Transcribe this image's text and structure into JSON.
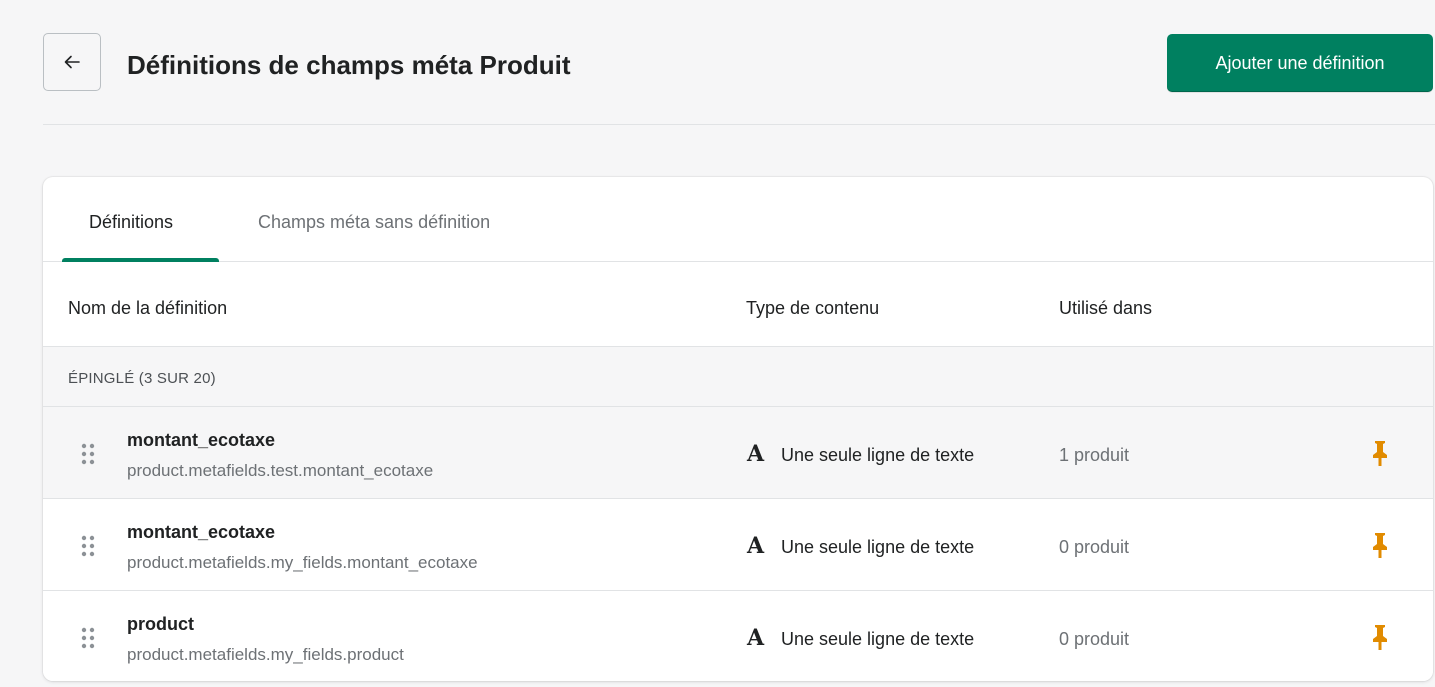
{
  "header": {
    "title": "Définitions de champs méta Produit",
    "primary_action": "Ajouter une définition",
    "back_icon": "arrow-left-icon"
  },
  "tabs": [
    {
      "label": "Définitions",
      "active": true
    },
    {
      "label": "Champs méta sans définition",
      "active": false
    }
  ],
  "table": {
    "columns": {
      "name": "Nom de la définition",
      "type": "Type de contenu",
      "used": "Utilisé dans"
    },
    "section_label": "ÉPINGLÉ (3 SUR 20)",
    "type_icon_glyph": "A",
    "rows": [
      {
        "name": "montant_ecotaxe",
        "key": "product.metafields.test.montant_ecotaxe",
        "type": "Une seule ligne de texte",
        "used": "1 produit",
        "pinned": true
      },
      {
        "name": "montant_ecotaxe",
        "key": "product.metafields.my_fields.montant_ecotaxe",
        "type": "Une seule ligne de texte",
        "used": "0 produit",
        "pinned": true
      },
      {
        "name": "product",
        "key": "product.metafields.my_fields.product",
        "type": "Une seule ligne de texte",
        "used": "0 produit",
        "pinned": true
      }
    ]
  },
  "colors": {
    "primary": "#008060",
    "pin": "#e18b00",
    "text": "#202223",
    "subdued": "#6d7175"
  }
}
